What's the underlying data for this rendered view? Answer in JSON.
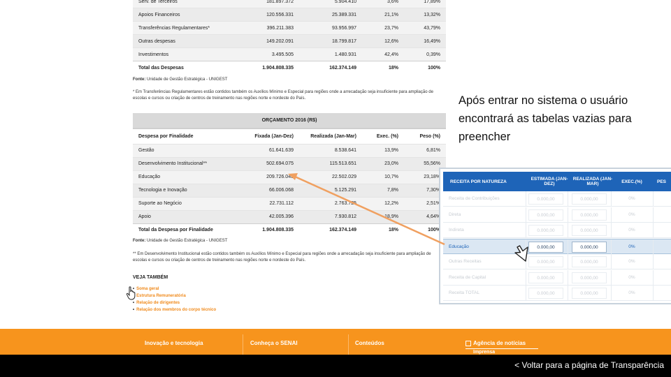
{
  "table1": {
    "rows": [
      {
        "label": "Serv. de Terceiros",
        "fixada": "181.897.372",
        "realizada": "5.904.410",
        "exec": "3,6%",
        "peso": "17,89%"
      },
      {
        "label": "Apoios Financeiros",
        "fixada": "120.556.331",
        "realizada": "25.389.331",
        "exec": "21,1%",
        "peso": "13,32%"
      },
      {
        "label": "Transferências Regulamentares*",
        "fixada": "396.211.383",
        "realizada": "93.956.997",
        "exec": "23,7%",
        "peso": "43,79%"
      },
      {
        "label": "Outras despesas",
        "fixada": "149.202.091",
        "realizada": "18.799.817",
        "exec": "12,6%",
        "peso": "16,49%"
      },
      {
        "label": "Investimentos",
        "fixada": "3.495.505",
        "realizada": "1.480.931",
        "exec": "42,4%",
        "peso": "0,39%"
      }
    ],
    "total": {
      "label": "Total das Despesas",
      "fixada": "1.904.808.335",
      "realizada": "162.374.149",
      "exec": "18%",
      "peso": "100%"
    }
  },
  "source_label": "Fonte:",
  "source_text": " Unidade de Gestão Estratégica - UNIGEST",
  "note1": "* Em Transferências Regulamentares estão contidos também os Auxílios Mínimo e Especial para regiões onde a arrecadação seja insuficiente para ampliação de escolas e cursos ou criação de centros de treinamento nas regiões norte e nordeste do País.",
  "table2": {
    "caption": "ORÇAMENTO 2016 (R$)",
    "headers": {
      "label": "Despesa por Finalidade",
      "fixada": "Fixada (Jan-Dez)",
      "realizada": "Realizada (Jan-Mar)",
      "exec": "Exec. (%)",
      "peso": "Peso (%)"
    },
    "rows": [
      {
        "label": "Gestão",
        "fixada": "61.641.639",
        "realizada": "8.538.641",
        "exec": "13,9%",
        "peso": "6,81%"
      },
      {
        "label": "Desenvolvimento Institucional**",
        "fixada": "502.694.075",
        "realizada": "115.513.651",
        "exec": "23,0%",
        "peso": "55,56%"
      },
      {
        "label": "Educação",
        "fixada": "209.726.045",
        "realizada": "22.502.029",
        "exec": "10,7%",
        "peso": "23,18%"
      },
      {
        "label": "Tecnologia e Inovação",
        "fixada": "66.006.068",
        "realizada": "5.125.291",
        "exec": "7,8%",
        "peso": "7,30%"
      },
      {
        "label": "Suporte ao Negócio",
        "fixada": "22.731.112",
        "realizada": "2.763.725",
        "exec": "12,2%",
        "peso": "2,51%"
      },
      {
        "label": "Apoio",
        "fixada": "42.005.396",
        "realizada": "7.930.812",
        "exec": "18,9%",
        "peso": "4,64%"
      }
    ],
    "total": {
      "label": "Total da Despesa por Finalidade",
      "fixada": "1.904.808.335",
      "realizada": "162.374.149",
      "exec": "18%",
      "peso": "100%"
    }
  },
  "note2": "** Em Desenvolvimento Institucional estão contidos também os Auxílios Mínimo e Especial para regiões onde a arrecadação seja insuficiente para ampliação de escolas e cursos ou criação de centros de treinamento nas regiões norte e nordeste do País.",
  "veja": {
    "title": "VEJA TAMBÉM",
    "links": [
      "Soma geral",
      "Estrutura Remuneratória",
      "Relação de dirigentes",
      "Relação dos membros do corpo técnico"
    ]
  },
  "footer": {
    "col1": "Inovação e tecnologia",
    "col2": "Conheça o SENAI",
    "col3": "Conteúdos",
    "agencia": "Agência de notícias",
    "imprensa": "Imprensa"
  },
  "back_link": "< Voltar para a página de Transparência",
  "explanation": "Após entrar no sistema o usuário encontrará as tabelas vazias para preencher",
  "panel": {
    "headers": {
      "natureza": "RECEITA POR NATUREZA",
      "estimada": "ESTIMADA (JAN-DEZ)",
      "realizada": "REALIZADA (JAN-MAR)",
      "exec": "EXEC.(%)",
      "peso": "PES"
    },
    "rows": [
      {
        "label": "Receita de Contribuições",
        "estimada": "0.000,00",
        "realizada": "0.000,00",
        "exec": "0%"
      },
      {
        "label": "Direta",
        "estimada": "0.000,00",
        "realizada": "0.000,00",
        "exec": "0%"
      },
      {
        "label": "Indireta",
        "estimada": "0.000,00",
        "realizada": "0.000,00",
        "exec": "0%"
      },
      {
        "label": "Educação",
        "estimada": "0.000,00",
        "realizada": "0.000,00",
        "exec": "0%"
      },
      {
        "label": "Outras Receitas",
        "estimada": "0.000,00",
        "realizada": "0.000,00",
        "exec": "0%"
      },
      {
        "label": "Receita de Capital",
        "estimada": "0.000,00",
        "realizada": "0.000,00",
        "exec": "0%"
      },
      {
        "label": "Receita TOTAL",
        "estimada": "0.000,00",
        "realizada": "0.000,00",
        "exec": "0%"
      }
    ]
  },
  "colors": {
    "accent_orange": "#f7941d",
    "link_orange": "#f08a1c",
    "panel_blue": "#1e64b8",
    "arrow": "#f0a060"
  }
}
